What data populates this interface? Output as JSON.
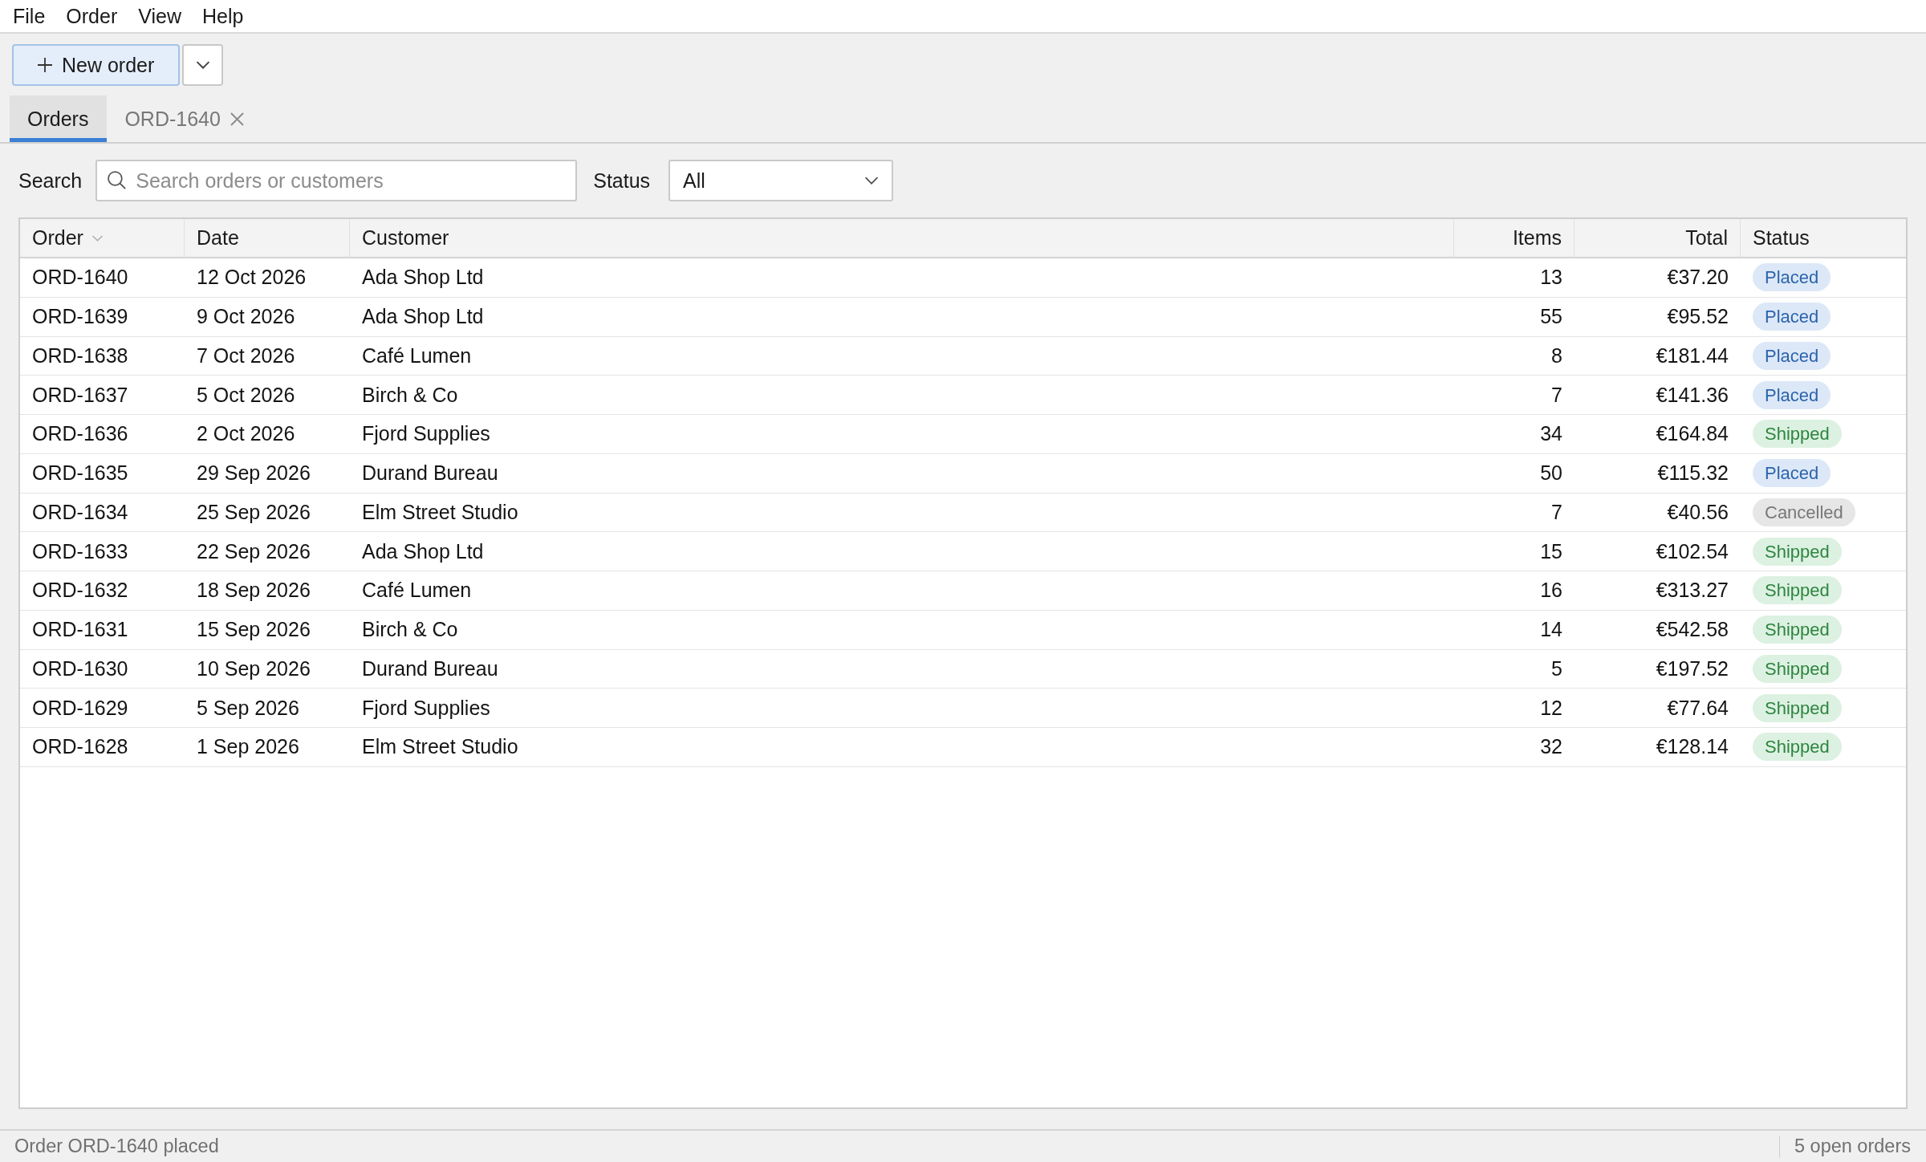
{
  "menu": [
    "File",
    "Order",
    "View",
    "Help"
  ],
  "toolbar": {
    "new_button": {
      "label": "New order"
    }
  },
  "tabs": [
    {
      "label": "Orders",
      "selected": true,
      "closable": false
    },
    {
      "label": "ORD-1640",
      "selected": false,
      "closable": true
    }
  ],
  "filters": {
    "search": {
      "label": "Search",
      "placeholder": "Search orders or customers"
    },
    "status": {
      "label": "Status",
      "value": "All"
    }
  },
  "table": {
    "columns": [
      {
        "label": "Order",
        "kind": "text",
        "sorted": true
      },
      {
        "label": "Date",
        "kind": "text",
        "sorted": false
      },
      {
        "label": "Customer",
        "kind": "text",
        "sorted": false
      },
      {
        "label": "Items",
        "kind": "number",
        "sorted": false
      },
      {
        "label": "Total",
        "kind": "number",
        "sorted": false
      },
      {
        "label": "Status",
        "kind": "badge",
        "sorted": false
      }
    ],
    "rows": [
      {
        "cells": [
          "ORD-1640",
          "12 Oct 2026",
          "Ada Shop Ltd",
          "13",
          "€37.20"
        ],
        "status": {
          "label": "Placed",
          "kind": "placed"
        }
      },
      {
        "cells": [
          "ORD-1639",
          "9 Oct 2026",
          "Ada Shop Ltd",
          "55",
          "€95.52"
        ],
        "status": {
          "label": "Placed",
          "kind": "placed"
        }
      },
      {
        "cells": [
          "ORD-1638",
          "7 Oct 2026",
          "Café Lumen",
          "8",
          "€181.44"
        ],
        "status": {
          "label": "Placed",
          "kind": "placed"
        }
      },
      {
        "cells": [
          "ORD-1637",
          "5 Oct 2026",
          "Birch & Co",
          "7",
          "€141.36"
        ],
        "status": {
          "label": "Placed",
          "kind": "placed"
        }
      },
      {
        "cells": [
          "ORD-1636",
          "2 Oct 2026",
          "Fjord Supplies",
          "34",
          "€164.84"
        ],
        "status": {
          "label": "Shipped",
          "kind": "shipped"
        }
      },
      {
        "cells": [
          "ORD-1635",
          "29 Sep 2026",
          "Durand Bureau",
          "50",
          "€115.32"
        ],
        "status": {
          "label": "Placed",
          "kind": "placed"
        }
      },
      {
        "cells": [
          "ORD-1634",
          "25 Sep 2026",
          "Elm Street Studio",
          "7",
          "€40.56"
        ],
        "status": {
          "label": "Cancelled",
          "kind": "cancelled"
        }
      },
      {
        "cells": [
          "ORD-1633",
          "22 Sep 2026",
          "Ada Shop Ltd",
          "15",
          "€102.54"
        ],
        "status": {
          "label": "Shipped",
          "kind": "shipped"
        }
      },
      {
        "cells": [
          "ORD-1632",
          "18 Sep 2026",
          "Café Lumen",
          "16",
          "€313.27"
        ],
        "status": {
          "label": "Shipped",
          "kind": "shipped"
        }
      },
      {
        "cells": [
          "ORD-1631",
          "15 Sep 2026",
          "Birch & Co",
          "14",
          "€542.58"
        ],
        "status": {
          "label": "Shipped",
          "kind": "shipped"
        }
      },
      {
        "cells": [
          "ORD-1630",
          "10 Sep 2026",
          "Durand Bureau",
          "5",
          "€197.52"
        ],
        "status": {
          "label": "Shipped",
          "kind": "shipped"
        }
      },
      {
        "cells": [
          "ORD-1629",
          "5 Sep 2026",
          "Fjord Supplies",
          "12",
          "€77.64"
        ],
        "status": {
          "label": "Shipped",
          "kind": "shipped"
        }
      },
      {
        "cells": [
          "ORD-1628",
          "1 Sep 2026",
          "Elm Street Studio",
          "32",
          "€128.14"
        ],
        "status": {
          "label": "Shipped",
          "kind": "shipped"
        }
      }
    ]
  },
  "status_bar": {
    "message": "Order ORD-1640 placed",
    "count": "5 open orders"
  }
}
